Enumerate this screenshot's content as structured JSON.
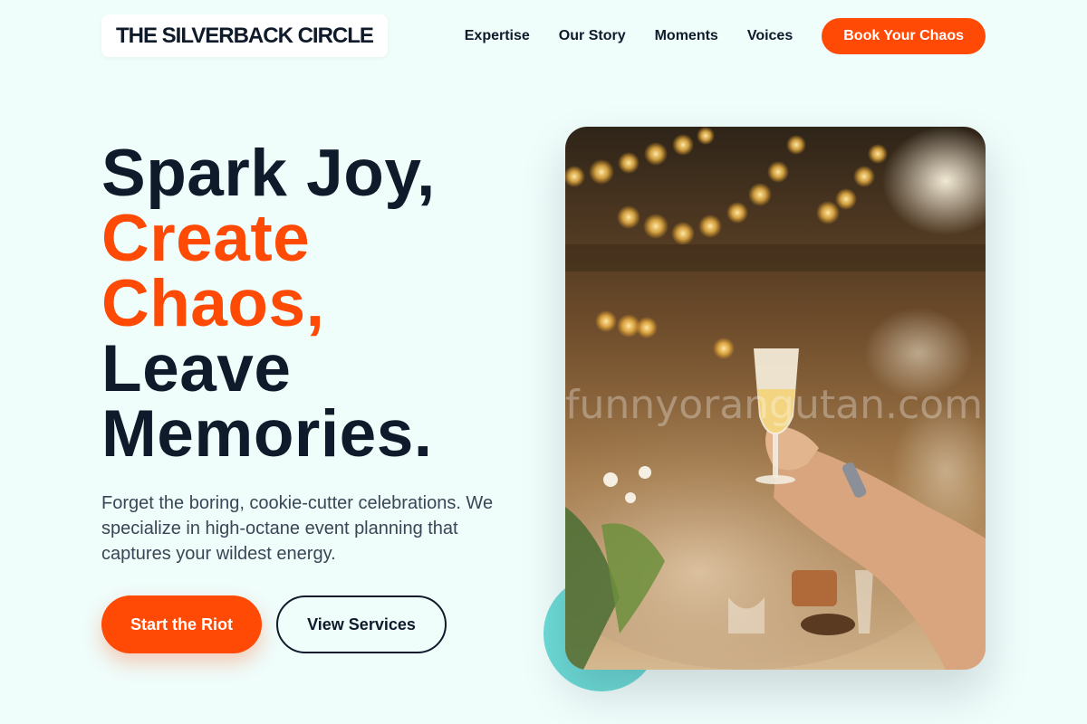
{
  "brand": {
    "name": "THE SILVERBACK CIRCLE"
  },
  "nav": {
    "links": [
      "Expertise",
      "Our Story",
      "Moments",
      "Voices"
    ],
    "cta_label": "Book Your Chaos"
  },
  "hero": {
    "headline_line1": "Spark Joy,",
    "headline_line2": "Create",
    "headline_line3": "Chaos,",
    "headline_line4": "Leave",
    "headline_line5": "Memories.",
    "description": "Forget the boring, cookie-cutter celebrations. We specialize in high-octane event planning that captures your wildest energy.",
    "primary_button": "Start the Riot",
    "secondary_button": "View Services",
    "image_watermark": "funnyorangutan.com"
  },
  "colors": {
    "accent": "#ff4a06",
    "dark": "#0f1a2b",
    "background": "#effdfb",
    "teal": "#6ddbd6"
  }
}
